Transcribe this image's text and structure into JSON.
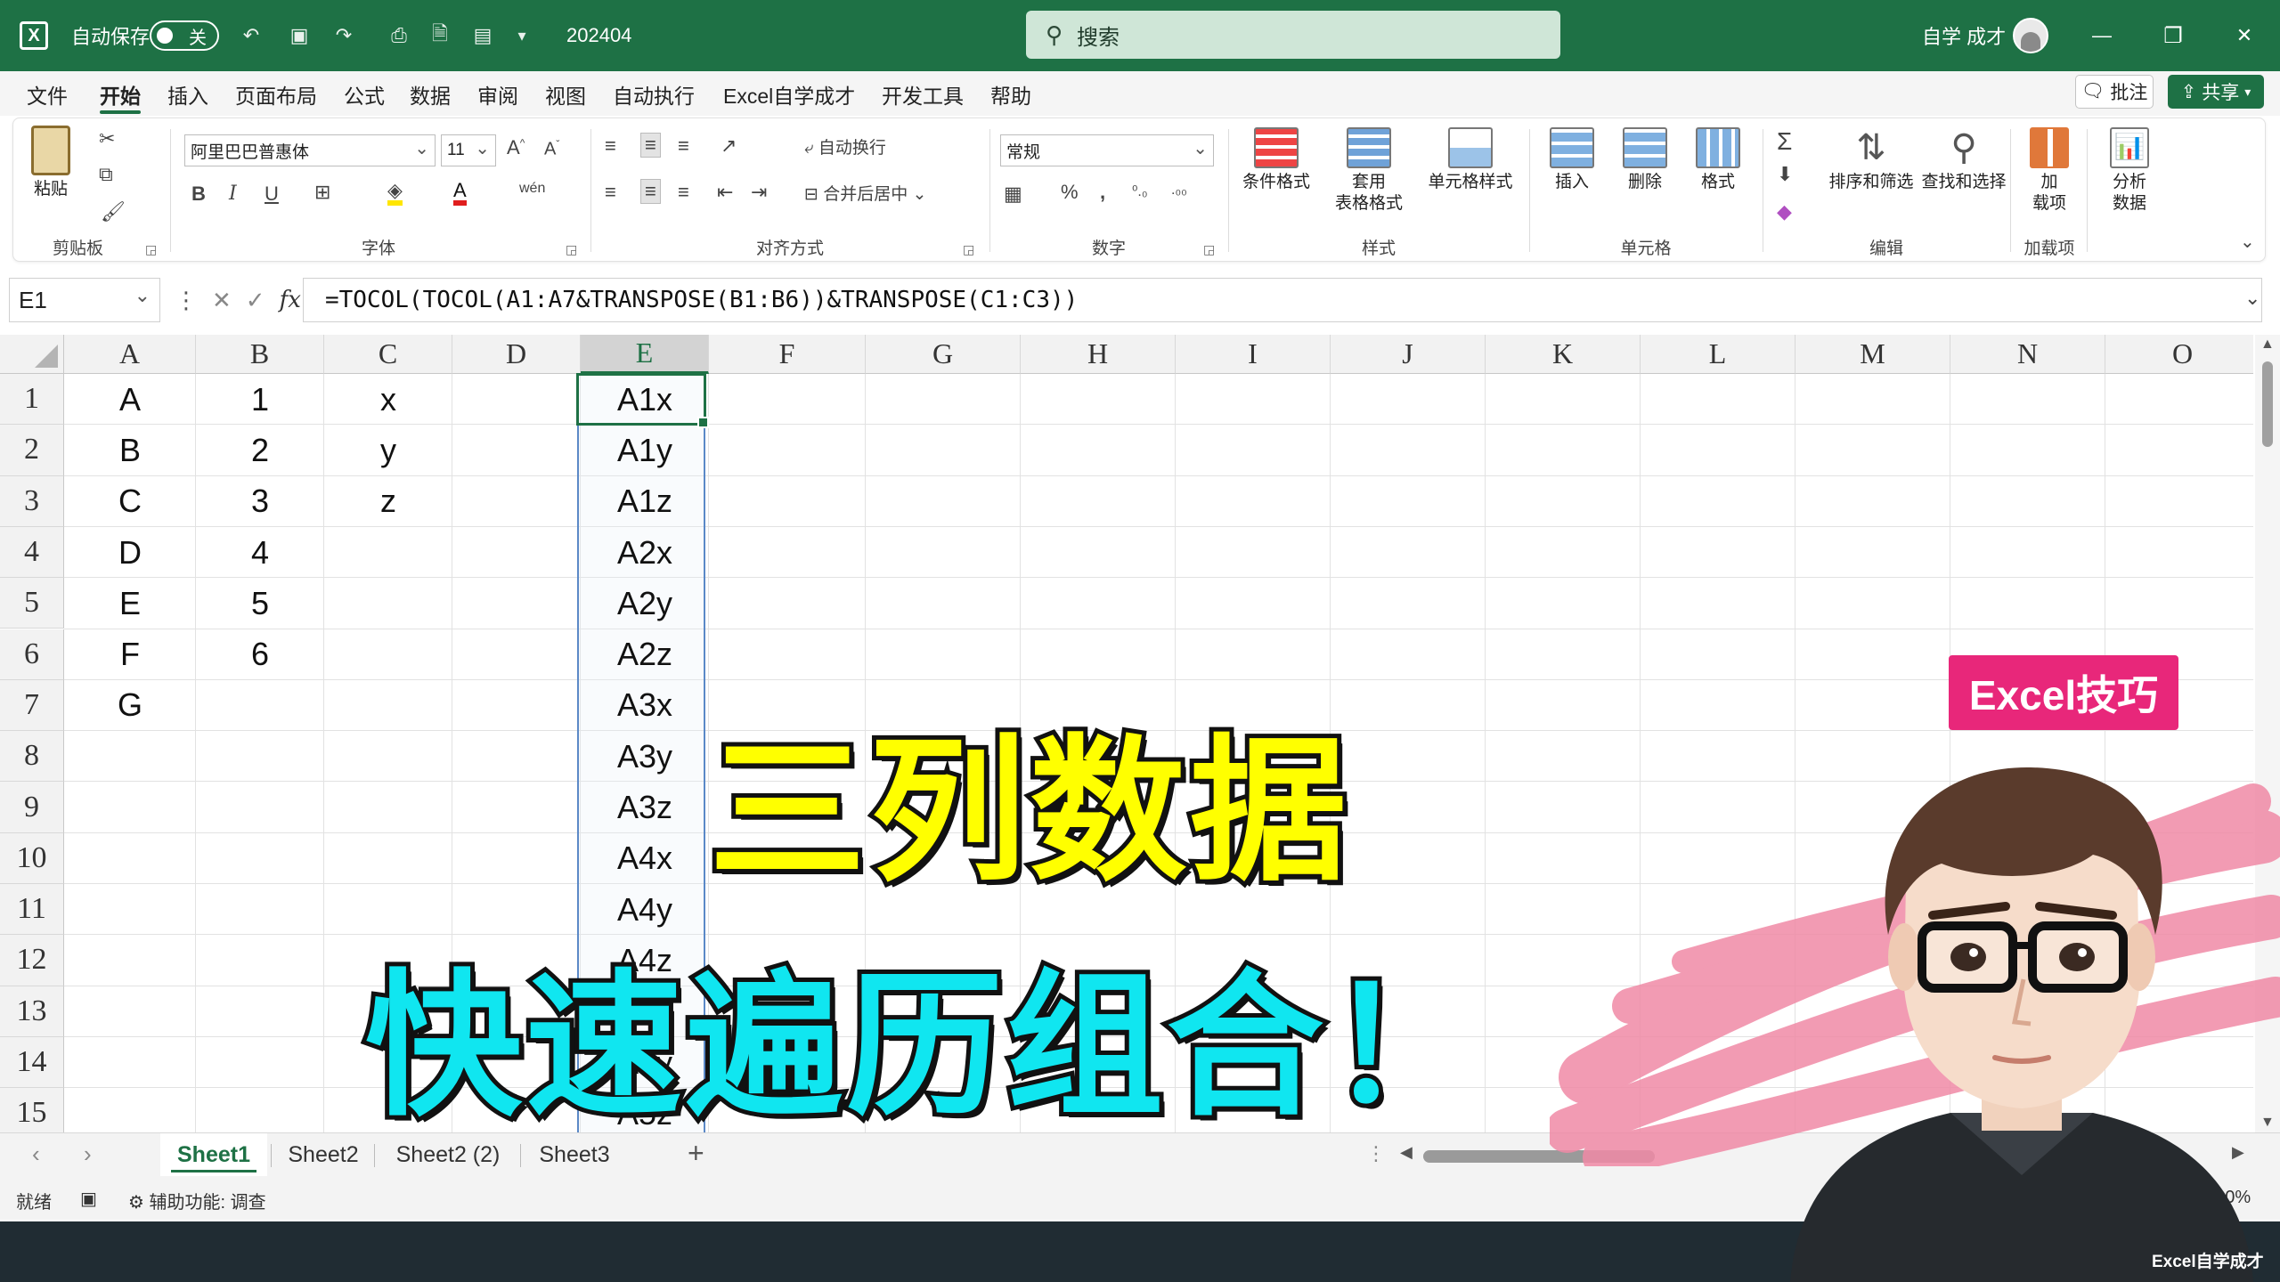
{
  "titlebar": {
    "autosave_label": "自动保存",
    "autosave_state": "关",
    "file_name": "202404",
    "search_placeholder": "搜索",
    "user_name": "自学 成才"
  },
  "menu": {
    "tabs": [
      "文件",
      "开始",
      "插入",
      "页面布局",
      "公式",
      "数据",
      "审阅",
      "视图",
      "自动执行",
      "Excel自学成才",
      "开发工具",
      "帮助"
    ],
    "active_tab": "开始",
    "comment_label": "批注",
    "share_label": "共享"
  },
  "ribbon": {
    "clipboard": {
      "paste": "粘贴",
      "group": "剪贴板"
    },
    "font": {
      "family": "阿里巴巴普惠体",
      "size": "11",
      "group": "字体",
      "bold": "B",
      "italic": "I",
      "underline": "U"
    },
    "alignment": {
      "wrap": "自动换行",
      "merge": "合并后居中",
      "group": "对齐方式"
    },
    "number": {
      "format": "常规",
      "group": "数字"
    },
    "styles": {
      "conditional": "条件格式",
      "table_1": "套用",
      "table_2": "表格格式",
      "cell_styles": "单元格样式",
      "group": "样式"
    },
    "cells": {
      "insert": "插入",
      "delete": "删除",
      "format": "格式",
      "group": "单元格"
    },
    "editing": {
      "sort": "排序和筛选",
      "find": "查找和选择",
      "group": "编辑"
    },
    "addins": {
      "addin_1": "加",
      "addin_2": "载项",
      "group": "加载项"
    },
    "analysis": {
      "label_1": "分析",
      "label_2": "数据"
    }
  },
  "formula_bar": {
    "name_box": "E1",
    "formula": "=TOCOL(TOCOL(A1:A7&TRANSPOSE(B1:B6))&TRANSPOSE(C1:C3))"
  },
  "grid": {
    "columns": [
      "A",
      "B",
      "C",
      "D",
      "E",
      "F",
      "G",
      "H",
      "I",
      "J",
      "K",
      "L",
      "M",
      "N",
      "O"
    ],
    "selected_column": "E",
    "rows": [
      "1",
      "2",
      "3",
      "4",
      "5",
      "6",
      "7",
      "8",
      "9",
      "10",
      "11",
      "12",
      "13",
      "14",
      "15"
    ],
    "col_a": [
      "A",
      "B",
      "C",
      "D",
      "E",
      "F",
      "G"
    ],
    "col_b": [
      "1",
      "2",
      "3",
      "4",
      "5",
      "6"
    ],
    "col_c": [
      "x",
      "y",
      "z"
    ],
    "col_e": [
      "A1x",
      "A1y",
      "A1z",
      "A2x",
      "A2y",
      "A2z",
      "A3x",
      "A3y",
      "A3z",
      "A4x",
      "A4y",
      "A4z",
      "A5x",
      "A5y",
      "A5z"
    ]
  },
  "sheets": {
    "tabs": [
      "Sheet1",
      "Sheet2",
      "Sheet2 (2)",
      "Sheet3"
    ],
    "active": "Sheet1"
  },
  "statusbar": {
    "ready": "就绪",
    "accessibility": "辅助功能: 调查",
    "zoom": "160%"
  },
  "overlay": {
    "line1": "三列数据",
    "line2": "快速遍历组合！",
    "tag": "Excel技巧",
    "watermark": "Excel自学成才"
  },
  "colors": {
    "brand_green": "#1e7145",
    "overlay_yellow": "#ffff00",
    "overlay_cyan": "#10e6f0",
    "tag_pink": "#e8277a"
  }
}
